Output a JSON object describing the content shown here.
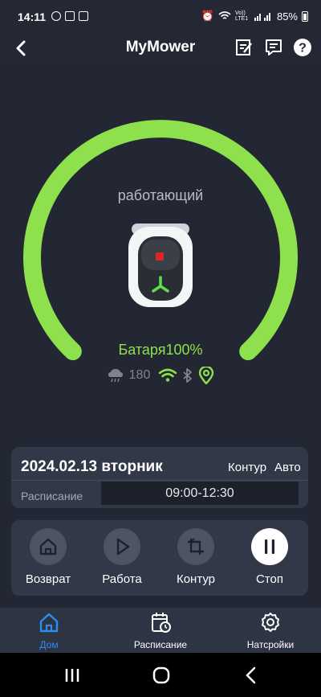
{
  "status_bar": {
    "time": "14:11",
    "network": "Vo)) LTE1",
    "battery": "85%"
  },
  "header": {
    "title": "MyMower"
  },
  "mower": {
    "state": "работающий",
    "battery_label": "Батаря100%",
    "battery_level": 1.0,
    "rain_delay": "180"
  },
  "schedule_card": {
    "date": "2024.02.13 вторник",
    "mode_contour": "Контур",
    "mode_auto": "Авто",
    "schedule_label": "Расписание",
    "schedule_time": "09:00-12:30"
  },
  "controls": [
    {
      "label": "Возврат",
      "icon": "home-icon"
    },
    {
      "label": "Работа",
      "icon": "play-icon"
    },
    {
      "label": "Контур",
      "icon": "edge-icon"
    },
    {
      "label": "Стоп",
      "icon": "pause-icon"
    }
  ],
  "tabs": [
    {
      "label": "Дом",
      "icon": "home-icon",
      "active": true
    },
    {
      "label": "Расписание",
      "icon": "calendar-icon",
      "active": false
    },
    {
      "label": "Натсройки",
      "icon": "gear-icon",
      "active": false
    }
  ],
  "colors": {
    "accent_green": "#8ee04c",
    "background": "#232834",
    "card": "#313847",
    "tab_active": "#2d8cf0"
  }
}
